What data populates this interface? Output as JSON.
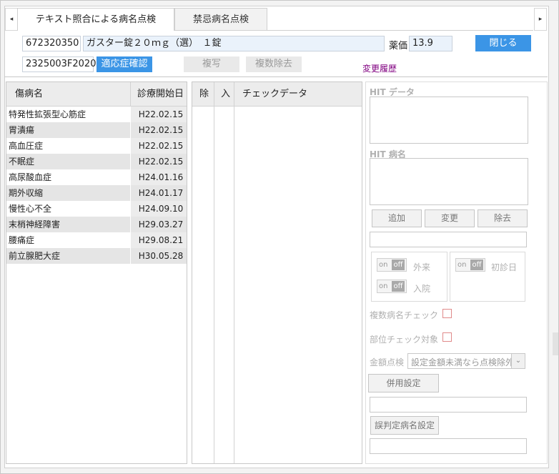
{
  "tabs": [
    {
      "label": "テキスト照合による病名点検"
    },
    {
      "label": "禁忌病名点検"
    }
  ],
  "scroll": {
    "left": "◂",
    "right": "▸"
  },
  "drug": {
    "code": "672320350",
    "name": "ガスター錠２０ｍｇ（選）　１錠",
    "price_label": "薬価",
    "price": "13.9",
    "yj_code": "2325003F2020"
  },
  "buttons": {
    "close": "閉じる",
    "indication": "適応症確認",
    "copy": "複写",
    "multi_remove": "複数除去",
    "history": "変更履歴",
    "add": "追加",
    "change": "変更",
    "remove": "除去",
    "combined": "併用設定",
    "misjudge": "誤判定病名設定"
  },
  "disease_table": {
    "headers": {
      "name": "傷病名",
      "date": "診療開始日"
    },
    "rows": [
      {
        "name": "特発性拡張型心筋症",
        "date": "H22.02.15"
      },
      {
        "name": "胃潰瘍",
        "date": "H22.02.15"
      },
      {
        "name": "高血圧症",
        "date": "H22.02.15"
      },
      {
        "name": "不眠症",
        "date": "H22.02.15"
      },
      {
        "name": "高尿酸血症",
        "date": "H24.01.16"
      },
      {
        "name": "期外収縮",
        "date": "H24.01.17"
      },
      {
        "name": "慢性心不全",
        "date": "H24.09.10"
      },
      {
        "name": "末梢神経障害",
        "date": "H29.03.27"
      },
      {
        "name": "腰痛症",
        "date": "H29.08.21"
      },
      {
        "name": "前立腺肥大症",
        "date": "H30.05.28"
      }
    ]
  },
  "check_table": {
    "headers": {
      "remove": "除",
      "enter": "入",
      "data": "チェックデータ"
    }
  },
  "right": {
    "hit_data": "HIT データ",
    "hit_name": "HIT 病名",
    "outpatient": "外来",
    "inpatient": "入院",
    "first_visit": "初診日",
    "toggle_on": "on",
    "toggle_off": "off",
    "multi_check": "複数病名チェック",
    "site_check": "部位チェック対象",
    "amount_check": "金額点検",
    "amount_select": "設定金額未満なら点検除外"
  },
  "colors": {
    "accent": "#3b95e6",
    "history": "#800080"
  }
}
